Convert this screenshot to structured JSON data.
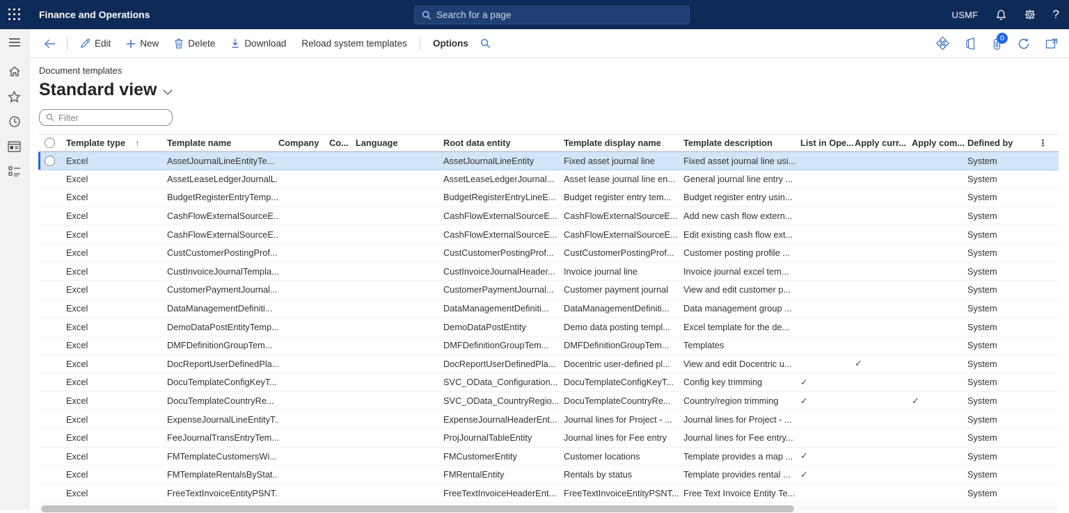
{
  "colors": {
    "topbar": "#0e2a56",
    "accent": "#2266e3",
    "command_icon": "#3b6fc2",
    "selected_row": "#d3e5f8"
  },
  "topbar": {
    "app_title": "Finance and Operations",
    "search_placeholder": "Search for a page",
    "company": "USMF",
    "icons": [
      "app-launcher-waffle",
      "search",
      "alerts-bell",
      "settings-gear",
      "help-question"
    ]
  },
  "sidebar": {
    "icons": [
      "hamburger-menu",
      "home",
      "favorites-star",
      "recent-clock",
      "workspaces",
      "modules-list"
    ]
  },
  "toolbar": {
    "back": "Back",
    "edit_label": "Edit",
    "new_label": "New",
    "delete_label": "Delete",
    "download_label": "Download",
    "reload_label": "Reload system templates",
    "options_label": "Options",
    "badge_count": "0",
    "right_icons": [
      "dynamics-diamond",
      "office-apps",
      "attachments-paperclip",
      "refresh",
      "open-in-new-window"
    ]
  },
  "page": {
    "subtitle": "Document templates",
    "view_title": "Standard view",
    "filter_placeholder": "Filter"
  },
  "grid": {
    "columns": [
      {
        "key": "type",
        "label": "Template type",
        "sorted": "asc"
      },
      {
        "key": "name",
        "label": "Template name"
      },
      {
        "key": "company",
        "label": "Company"
      },
      {
        "key": "co",
        "label": "Co..."
      },
      {
        "key": "language",
        "label": "Language"
      },
      {
        "key": "root",
        "label": "Root data entity"
      },
      {
        "key": "display",
        "label": "Template display name"
      },
      {
        "key": "desc",
        "label": "Template description"
      },
      {
        "key": "list",
        "label": "List in Ope..."
      },
      {
        "key": "curr",
        "label": "Apply curr..."
      },
      {
        "key": "com",
        "label": "Apply com..."
      },
      {
        "key": "defined",
        "label": "Defined by"
      }
    ],
    "rows": [
      {
        "selected": true,
        "type": "Excel",
        "name": "AssetJournalLineEntityTe...",
        "company": "",
        "co": "",
        "language": "",
        "root": "AssetJournalLineEntity",
        "display": "Fixed asset journal line",
        "desc": "Fixed asset journal line usi...",
        "list": false,
        "curr": false,
        "com": false,
        "defined": "System"
      },
      {
        "selected": false,
        "type": "Excel",
        "name": "AssetLeaseLedgerJournalL...",
        "company": "",
        "co": "",
        "language": "",
        "root": "AssetLeaseLedgerJournal...",
        "display": "Asset lease journal line en...",
        "desc": "General journal line entry ...",
        "list": false,
        "curr": false,
        "com": false,
        "defined": "System"
      },
      {
        "selected": false,
        "type": "Excel",
        "name": "BudgetRegisterEntryTemp...",
        "company": "",
        "co": "",
        "language": "",
        "root": "BudgetRegisterEntryLineE...",
        "display": "Budget register entry tem...",
        "desc": "Budget register entry usin...",
        "list": false,
        "curr": false,
        "com": false,
        "defined": "System"
      },
      {
        "selected": false,
        "type": "Excel",
        "name": "CashFlowExternalSourceE...",
        "company": "",
        "co": "",
        "language": "",
        "root": "CashFlowExternalSourceE...",
        "display": "CashFlowExternalSourceE...",
        "desc": "Add new cash flow extern...",
        "list": false,
        "curr": false,
        "com": false,
        "defined": "System"
      },
      {
        "selected": false,
        "type": "Excel",
        "name": "CashFlowExternalSourceE...",
        "company": "",
        "co": "",
        "language": "",
        "root": "CashFlowExternalSourceE...",
        "display": "CashFlowExternalSourceE...",
        "desc": "Edit existing cash flow ext...",
        "list": false,
        "curr": false,
        "com": false,
        "defined": "System"
      },
      {
        "selected": false,
        "type": "Excel",
        "name": "CustCustomerPostingProf...",
        "company": "",
        "co": "",
        "language": "",
        "root": "CustCustomerPostingProf...",
        "display": "CustCustomerPostingProf...",
        "desc": "Customer posting profile ...",
        "list": false,
        "curr": false,
        "com": false,
        "defined": "System"
      },
      {
        "selected": false,
        "type": "Excel",
        "name": "CustInvoiceJournalTempla...",
        "company": "",
        "co": "",
        "language": "",
        "root": "CustInvoiceJournalHeader...",
        "display": "Invoice journal line",
        "desc": "Invoice journal excel tem...",
        "list": false,
        "curr": false,
        "com": false,
        "defined": "System"
      },
      {
        "selected": false,
        "type": "Excel",
        "name": "CustomerPaymentJournal...",
        "company": "",
        "co": "",
        "language": "",
        "root": "CustomerPaymentJournal...",
        "display": "Customer payment journal",
        "desc": "View and edit customer p...",
        "list": false,
        "curr": false,
        "com": false,
        "defined": "System"
      },
      {
        "selected": false,
        "type": "Excel",
        "name": "DataManagementDefiniti...",
        "company": "",
        "co": "",
        "language": "",
        "root": "DataManagementDefiniti...",
        "display": "DataManagementDefiniti...",
        "desc": "Data management group ...",
        "list": false,
        "curr": false,
        "com": false,
        "defined": "System"
      },
      {
        "selected": false,
        "type": "Excel",
        "name": "DemoDataPostEntityTemp...",
        "company": "",
        "co": "",
        "language": "",
        "root": "DemoDataPostEntity",
        "display": "Demo data posting templ...",
        "desc": "Excel template for the de...",
        "list": false,
        "curr": false,
        "com": false,
        "defined": "System"
      },
      {
        "selected": false,
        "type": "Excel",
        "name": "DMFDefinitionGroupTem...",
        "company": "",
        "co": "",
        "language": "",
        "root": "DMFDefinitionGroupTem...",
        "display": "DMFDefinitionGroupTem...",
        "desc": "Templates",
        "list": false,
        "curr": false,
        "com": false,
        "defined": "System"
      },
      {
        "selected": false,
        "type": "Excel",
        "name": "DocReportUserDefinedPla...",
        "company": "",
        "co": "",
        "language": "",
        "root": "DocReportUserDefinedPla...",
        "display": "Docentric user-defined pl...",
        "desc": "View and edit Docentric u...",
        "list": false,
        "curr": true,
        "com": false,
        "defined": "System"
      },
      {
        "selected": false,
        "type": "Excel",
        "name": "DocuTemplateConfigKeyT...",
        "company": "",
        "co": "",
        "language": "",
        "root": "SVC_OData_Configuration...",
        "display": "DocuTemplateConfigKeyT...",
        "desc": "Config key trimming",
        "list": true,
        "curr": false,
        "com": false,
        "defined": "System"
      },
      {
        "selected": false,
        "type": "Excel",
        "name": "DocuTemplateCountryRe...",
        "company": "",
        "co": "",
        "language": "",
        "root": "SVC_OData_CountryRegio...",
        "display": "DocuTemplateCountryRe...",
        "desc": "Country/region trimming",
        "list": true,
        "curr": false,
        "com": true,
        "defined": "System"
      },
      {
        "selected": false,
        "type": "Excel",
        "name": "ExpenseJournalLineEntityT...",
        "company": "",
        "co": "",
        "language": "",
        "root": "ExpenseJournalHeaderEnt...",
        "display": "Journal lines for Project - ...",
        "desc": "Journal lines for Project - ...",
        "list": false,
        "curr": false,
        "com": false,
        "defined": "System"
      },
      {
        "selected": false,
        "type": "Excel",
        "name": "FeeJournalTransEntryTem...",
        "company": "",
        "co": "",
        "language": "",
        "root": "ProjJournalTableEntity",
        "display": "Journal lines for Fee entry",
        "desc": "Journal lines for Fee entry...",
        "list": false,
        "curr": false,
        "com": false,
        "defined": "System"
      },
      {
        "selected": false,
        "type": "Excel",
        "name": "FMTemplateCustomersWi...",
        "company": "",
        "co": "",
        "language": "",
        "root": "FMCustomerEntity",
        "display": "Customer locations",
        "desc": "Template provides a map ...",
        "list": true,
        "curr": false,
        "com": false,
        "defined": "System"
      },
      {
        "selected": false,
        "type": "Excel",
        "name": "FMTemplateRentalsByStat...",
        "company": "",
        "co": "",
        "language": "",
        "root": "FMRentalEntity",
        "display": "Rentals by status",
        "desc": "Template provides rental ...",
        "list": true,
        "curr": false,
        "com": false,
        "defined": "System"
      },
      {
        "selected": false,
        "type": "Excel",
        "name": "FreeTextInvoiceEntityPSNT...",
        "company": "",
        "co": "",
        "language": "",
        "root": "FreeTextInvoiceHeaderEnt...",
        "display": "FreeTextInvoiceEntityPSNT...",
        "desc": "Free Text Invoice Entity Te...",
        "list": false,
        "curr": false,
        "com": false,
        "defined": "System"
      }
    ]
  }
}
